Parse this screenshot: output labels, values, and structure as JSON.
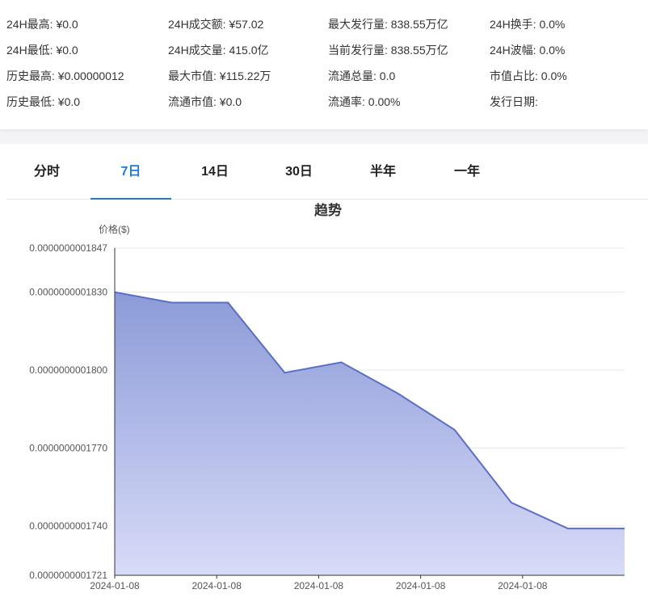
{
  "stats": [
    {
      "label": "24H最高:",
      "value": "¥0.0"
    },
    {
      "label": "24H成交额:",
      "value": "¥57.02"
    },
    {
      "label": "最大发行量:",
      "value": "838.55万亿"
    },
    {
      "label": "24H换手:",
      "value": "0.0%"
    },
    {
      "label": "24H最低:",
      "value": "¥0.0"
    },
    {
      "label": "24H成交量:",
      "value": "415.0亿"
    },
    {
      "label": "当前发行量:",
      "value": "838.55万亿"
    },
    {
      "label": "24H波幅:",
      "value": "0.0%"
    },
    {
      "label": "历史最高:",
      "value": "¥0.00000012"
    },
    {
      "label": "最大市值:",
      "value": "¥115.22万"
    },
    {
      "label": "流通总量:",
      "value": "0.0"
    },
    {
      "label": "市值占比:",
      "value": "0.0%"
    },
    {
      "label": "历史最低:",
      "value": "¥0.0"
    },
    {
      "label": "流通市值:",
      "value": "¥0.0"
    },
    {
      "label": "流通率:",
      "value": "0.00%"
    },
    {
      "label": "发行日期:",
      "value": ""
    }
  ],
  "tabs": [
    {
      "label": "分时",
      "active": false
    },
    {
      "label": "7日",
      "active": true
    },
    {
      "label": "14日",
      "active": false
    },
    {
      "label": "30日",
      "active": false
    },
    {
      "label": "半年",
      "active": false
    },
    {
      "label": "一年",
      "active": false
    }
  ],
  "chart_data": {
    "type": "area",
    "title": "趋势",
    "ylabel": "价格($)",
    "xlabel": "",
    "ylim": [
      1.721e-10,
      1.847e-10
    ],
    "yticks": [
      "0.0000000001847",
      "0.0000000001830",
      "0.0000000001800",
      "0.0000000001770",
      "0.0000000001740",
      "0.0000000001721"
    ],
    "xtick_labels": [
      "2024-01-08",
      "2024-01-08",
      "2024-01-08",
      "2024-01-08",
      "2024-01-08"
    ],
    "grid": true,
    "series": [
      {
        "values": [
          1.83e-10,
          1.826e-10,
          1.826e-10,
          1.799e-10,
          1.803e-10,
          1.791e-10,
          1.777e-10,
          1.749e-10,
          1.739e-10,
          1.739e-10
        ]
      }
    ],
    "colors": {
      "line": "#5a6fc4",
      "fill_top": "#8c9bd8",
      "fill_bottom": "#d8dbf8"
    }
  }
}
